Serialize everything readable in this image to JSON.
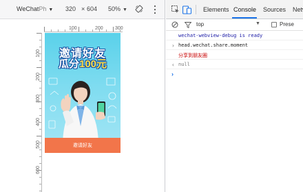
{
  "device_toolbar": {
    "device": "WeChat",
    "device_suffix": "Ph",
    "width": "320",
    "times": "×",
    "height": "604",
    "zoom": "50%",
    "icons": [
      "chevron-down-icon",
      "rotate-icon",
      "more-vert-icon"
    ]
  },
  "rulers": {
    "top_labels": [
      "100",
      "200",
      "300"
    ],
    "left_labels": [
      "100",
      "200",
      "300",
      "400",
      "500",
      "600"
    ]
  },
  "poster": {
    "title_line_1": "邀请好友",
    "title_line_2_prefix": "瓜分",
    "title_line_2_highlight": "100元",
    "button_text": "邀请好友",
    "colors": {
      "background": "#5ad1ea",
      "title_outline": "#1a4fa0",
      "highlight": "#ffe14a",
      "button": "#f2754a"
    }
  },
  "devtools": {
    "tabs": [
      "Elements",
      "Console",
      "Sources",
      "Netw"
    ],
    "active_tab": "Console",
    "accent_color": "#1a73e8",
    "console_toolbar": {
      "context": "top",
      "preserve_label": "Prese"
    },
    "console_lines": [
      {
        "prefix": "",
        "text": "wechat-webview-debug is ready"
      },
      {
        "prefix": "›",
        "text": "head.wechat.share.moment"
      },
      {
        "prefix": "",
        "text": "分享到朋友圈"
      },
      {
        "prefix": "‹",
        "text": "null"
      }
    ],
    "prompt": "›"
  }
}
